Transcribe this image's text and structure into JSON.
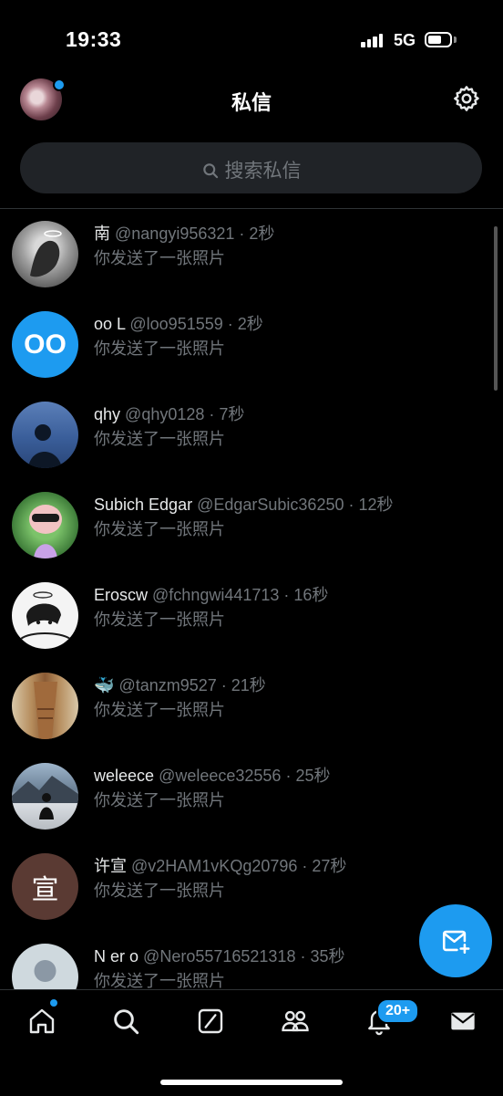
{
  "status_bar": {
    "time": "19:33",
    "network": "5G"
  },
  "header": {
    "title": "私信"
  },
  "search": {
    "placeholder": "搜索私信"
  },
  "conversations": [
    {
      "name": "南",
      "handle": "@nangyi956321",
      "time": "2秒",
      "preview": "你发送了一张照片",
      "avatar": "sketch-halo",
      "avatar_text": ""
    },
    {
      "name": "oo L",
      "handle": "@loo951559",
      "time": "2秒",
      "preview": "你发送了一张照片",
      "avatar": "letters",
      "avatar_text": "OO"
    },
    {
      "name": "qhy",
      "handle": "@qhy0128",
      "time": "7秒",
      "preview": "你发送了一张照片",
      "avatar": "silhouette-sea",
      "avatar_text": ""
    },
    {
      "name": "Subich Edgar",
      "handle": "@EdgarSubic36250",
      "time": "12秒",
      "preview": "你发送了一张照片",
      "avatar": "cartoon-sunglasses",
      "avatar_text": ""
    },
    {
      "name": "Eroscw",
      "handle": "@fchngwi441713",
      "time": "16秒",
      "preview": "你发送了一张照片",
      "avatar": "anime-sketch",
      "avatar_text": ""
    },
    {
      "name": "🐳",
      "handle": "@tanzm9527",
      "time": "21秒",
      "preview": "你发送了一张照片",
      "avatar": "photo-person",
      "avatar_text": ""
    },
    {
      "name": "weleece",
      "handle": "@weleece32556",
      "time": "25秒",
      "preview": "你发送了一张照片",
      "avatar": "mountain-snow",
      "avatar_text": ""
    },
    {
      "name": "许宣",
      "handle": "@v2HAM1vKQg20796",
      "time": "27秒",
      "preview": "你发送了一张照片",
      "avatar": "letters",
      "avatar_text": "宣"
    },
    {
      "name": "N er o",
      "handle": "@Nero55716521318",
      "time": "35秒",
      "preview": "你发送了一张照片",
      "avatar": "default-person",
      "avatar_text": ""
    }
  ],
  "tabbar": {
    "items": [
      "home-icon",
      "search-icon",
      "grok-icon",
      "communities-icon",
      "notifications-icon",
      "messages-icon"
    ],
    "notifications_badge": "20+"
  },
  "colors": {
    "accent": "#1d9bf0",
    "background": "#000000",
    "muted": "#71767b",
    "search_bg": "#202327"
  }
}
